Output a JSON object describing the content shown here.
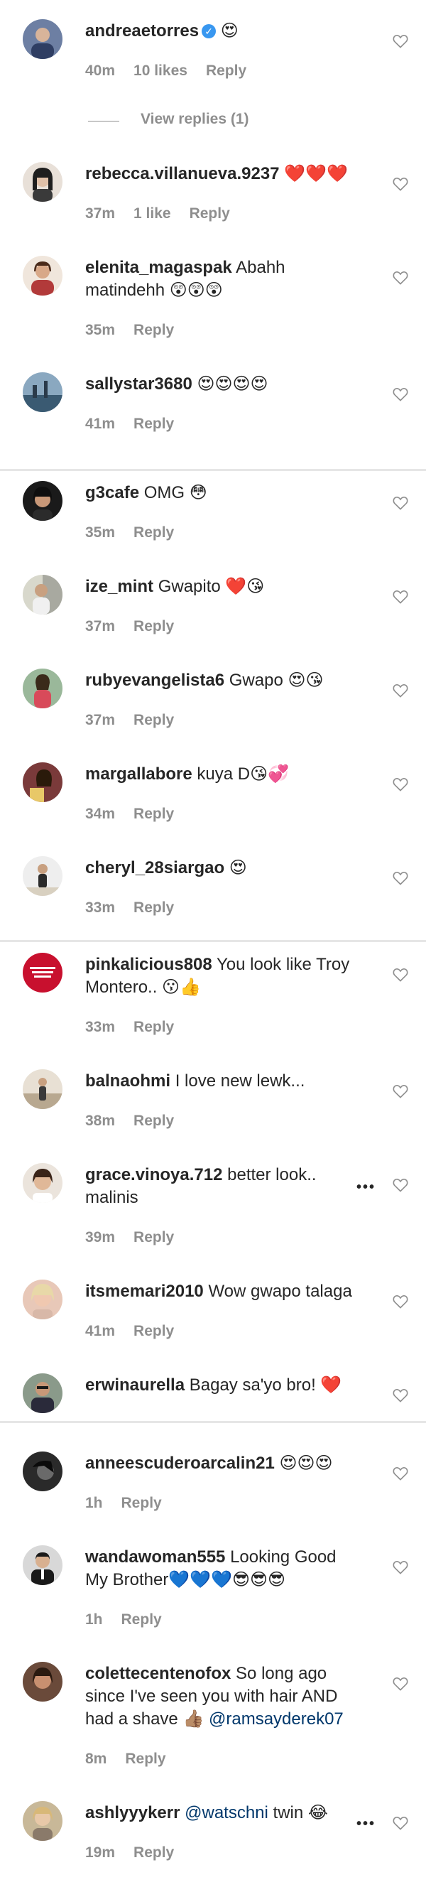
{
  "comments": [
    {
      "username": "andreaetorres",
      "verified": true,
      "text": "😍",
      "time": "40m",
      "likes": "10 likes",
      "reply": "Reply",
      "view_replies": "View replies (1)",
      "avatar_color": "#6d7fa3"
    },
    {
      "username": "rebecca.villanueva.9237",
      "text": "❤️❤️❤️",
      "time": "37m",
      "likes": "1 like",
      "reply": "Reply",
      "avatar_color": "#3a3a3a"
    },
    {
      "username": "elenita_magaspak",
      "text": "Abahh matindehh 😲😲😲",
      "time": "35m",
      "reply": "Reply",
      "avatar_color": "#b23a3a"
    },
    {
      "username": "sallystar3680",
      "text": "😍😍😍😍",
      "time": "41m",
      "reply": "Reply",
      "avatar_color": "#4a6b8a"
    },
    {
      "username": "g3cafe",
      "text": "OMG 😳",
      "time": "35m",
      "reply": "Reply",
      "avatar_color": "#2b2b2b"
    },
    {
      "username": "ize_mint",
      "text": "Gwapito ❤️😘",
      "time": "37m",
      "reply": "Reply",
      "avatar_color": "#a8a9a0"
    },
    {
      "username": "rubyevangelista6",
      "text": "Gwapo 😍😘",
      "time": "37m",
      "reply": "Reply",
      "avatar_color": "#6b8f6b"
    },
    {
      "username": "margallabore",
      "text": "kuya D😘💞",
      "time": "34m",
      "reply": "Reply",
      "avatar_color": "#8a4a4a"
    },
    {
      "username": "cheryl_28siargao",
      "text": "😍",
      "time": "33m",
      "reply": "Reply",
      "avatar_color": "#d9d9d9"
    },
    {
      "username": "pinkalicious808",
      "text": "You look like Troy Montero.. 😗👍",
      "time": "33m",
      "reply": "Reply",
      "avatar_color": "#c8102e"
    },
    {
      "username": "balnaohmi",
      "text": "I love new lewk...",
      "time": "38m",
      "reply": "Reply",
      "avatar_color": "#c9b8a0"
    },
    {
      "username": "grace.vinoya.712",
      "text": "better look.. malinis",
      "time": "39m",
      "reply": "Reply",
      "more": "•••",
      "avatar_color": "#cfc8c0"
    },
    {
      "username": "itsmemari2010",
      "text": "Wow gwapo talaga",
      "time": "41m",
      "reply": "Reply",
      "avatar_color": "#d8b8a8"
    },
    {
      "username": "erwinaurella",
      "text": "Bagay sa'yo bro! ❤️",
      "avatar_color": "#5a6a5a"
    },
    {
      "username": "anneescuderoarcalin21",
      "text": "😍😍😍",
      "time": "1h",
      "reply": "Reply",
      "avatar_color": "#3d3d3d"
    },
    {
      "username": "wandawoman555",
      "text": "Looking Good My Brother💙💙💙😎😎😎",
      "time": "1h",
      "reply": "Reply",
      "avatar_color": "#2a2a2a"
    },
    {
      "username": "colettecentenofox",
      "text": "So long ago since I've seen you with hair AND had a shave 👍🏽",
      "mention": "@ramsayderek07",
      "time": "8m",
      "reply": "Reply",
      "avatar_color": "#6a4a3a"
    },
    {
      "username": "ashlyyykerr",
      "mention": "@watschni",
      "text": "twin 😂",
      "time": "19m",
      "reply": "Reply",
      "more": "•••",
      "avatar_color": "#c8b898"
    }
  ]
}
